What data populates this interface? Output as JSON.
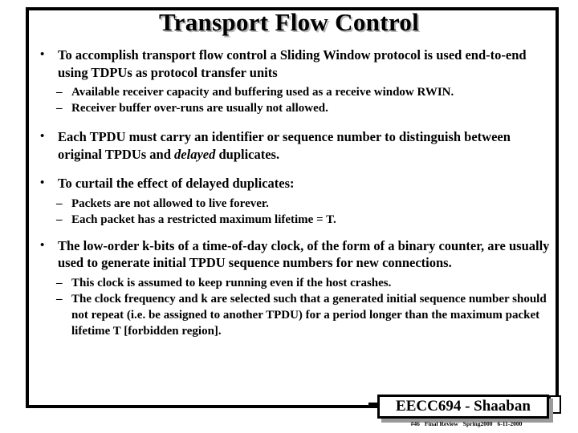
{
  "slide": {
    "title": "Transport Flow Control",
    "bullet_marker": "•",
    "dash_marker": "–",
    "content": {
      "b1": "To accomplish transport flow control a Sliding Window protocol is used end-to-end using TDPUs as protocol transfer units",
      "b1_s1": "Available receiver capacity and buffering used as a receive window RWIN.",
      "b1_s2": "Receiver buffer over-runs are usually not allowed.",
      "b2_part1": "Each TPDU must carry an identifier or sequence number to distinguish between original TPDUs and ",
      "b2_italic": "delayed",
      "b2_part2": " duplicates.",
      "b3": "To curtail the effect of delayed duplicates:",
      "b3_s1": "Packets are not allowed to live forever.",
      "b3_s2": "Each packet has a restricted  maximum lifetime = T.",
      "b4": "The low-order k-bits of a time-of-day clock, of the form of a binary counter,  are usually used to generate initial TPDU sequence numbers for new connections.",
      "b4_s1": "This clock is assumed to keep running even if the host crashes.",
      "b4_s2": "The clock frequency and  k  are selected such that a generated initial sequence number should not repeat (i.e. be assigned to another TPDU) for a period longer than the maximum packet lifetime T [forbidden region]."
    }
  },
  "footer": {
    "badge_label": "EECC694 - Shaaban",
    "credit_slide": "#46",
    "credit_course": "Final Review",
    "credit_term": "Spring2000",
    "credit_date": "6-11-2000"
  },
  "colors": {
    "text": "#000000",
    "background": "#ffffff",
    "frame": "#000000",
    "title_shadow": "#b6b6b6",
    "badge_shadow": "#9a9a9a"
  }
}
